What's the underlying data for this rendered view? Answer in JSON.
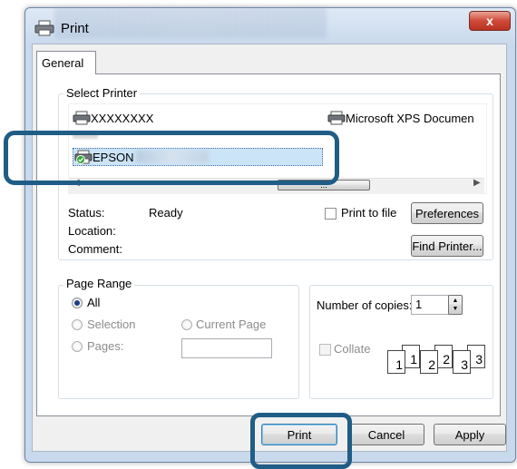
{
  "window": {
    "title": "Print",
    "close_glyph": "x"
  },
  "tabs": [
    {
      "label": "General",
      "selected": true
    }
  ],
  "select_printer": {
    "group_label": "Select Printer",
    "printers": [
      {
        "name": "XXXXXXXX",
        "icon": "printer-icon"
      },
      {
        "name": "Microsoft XPS Documen",
        "icon": "printer-icon"
      },
      {
        "name": "EPSON",
        "icon": "printer-default-icon",
        "selected": true
      }
    ],
    "scroll_thumb_glyph": "...",
    "status_label": "Status:",
    "status_value": "Ready",
    "location_label": "Location:",
    "location_value": "",
    "comment_label": "Comment:",
    "comment_value": "",
    "print_to_file_label": "Print to file",
    "preferences_label": "Preferences",
    "find_printer_label": "Find Printer..."
  },
  "page_range": {
    "group_label": "Page Range",
    "all_label": "All",
    "selection_label": "Selection",
    "current_page_label": "Current Page",
    "pages_label": "Pages:",
    "pages_value": "",
    "selected": "All"
  },
  "copies": {
    "number_label": "Number of copies:",
    "number_value": "1",
    "collate_label": "Collate",
    "collate_checked": false,
    "collate_pages": [
      "1",
      "1",
      "2",
      "2",
      "3",
      "3"
    ]
  },
  "footer": {
    "print_label": "Print",
    "cancel_label": "Cancel",
    "apply_label": "Apply"
  },
  "colors": {
    "highlight_ring": "#1f5d86",
    "selection": "#cce4f7",
    "close_button": "#cf4a3a"
  }
}
